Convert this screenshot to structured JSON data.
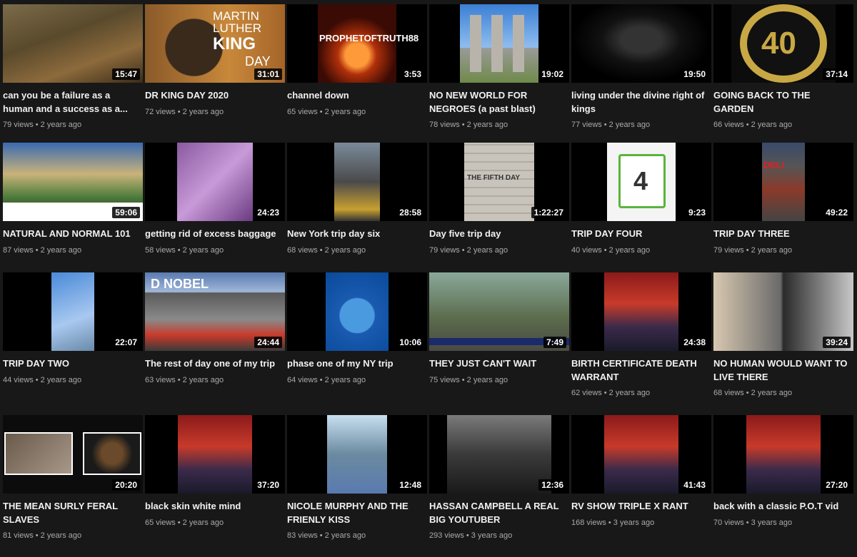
{
  "videos": [
    {
      "title": "can you be a failure as a human and a success as a...",
      "views": "79 views",
      "age": "2 years ago",
      "duration": "15:47"
    },
    {
      "title": "DR KING DAY 2020",
      "views": "72 views",
      "age": "2 years ago",
      "duration": "31:01",
      "art_text": [
        "MARTIN LUTHER",
        "KING",
        "DAY"
      ]
    },
    {
      "title": "channel down",
      "views": "65 views",
      "age": "2 years ago",
      "duration": "3:53",
      "art_text": [
        "PROPHETOFTRUTH88"
      ]
    },
    {
      "title": "NO NEW WORLD FOR NEGROES (a past blast)",
      "views": "78 views",
      "age": "2 years ago",
      "duration": "19:02"
    },
    {
      "title": "living under the divine right of kings",
      "views": "77 views",
      "age": "2 years ago",
      "duration": "19:50"
    },
    {
      "title": "GOING BACK TO THE GARDEN",
      "views": "66 views",
      "age": "2 years ago",
      "duration": "37:14",
      "art_text": [
        "40"
      ]
    },
    {
      "title": "NATURAL AND NORMAL 101",
      "views": "87 views",
      "age": "2 years ago",
      "duration": "59:06"
    },
    {
      "title": "getting rid of excess baggage",
      "views": "58 views",
      "age": "2 years ago",
      "duration": "24:23"
    },
    {
      "title": "New York trip day six",
      "views": "68 views",
      "age": "2 years ago",
      "duration": "28:58"
    },
    {
      "title": "Day five trip day",
      "views": "79 views",
      "age": "2 years ago",
      "duration": "1:22:27",
      "art_text": [
        "THE FIFTH DAY"
      ]
    },
    {
      "title": "TRIP DAY FOUR",
      "views": "40 views",
      "age": "2 years ago",
      "duration": "9:23",
      "art_text": [
        "4"
      ]
    },
    {
      "title": "TRIP DAY THREE",
      "views": "79 views",
      "age": "2 years ago",
      "duration": "49:22",
      "art_text": [
        "DELI"
      ]
    },
    {
      "title": "TRIP DAY TWO",
      "views": "44 views",
      "age": "2 years ago",
      "duration": "22:07"
    },
    {
      "title": "The rest of day one of my trip",
      "views": "63 views",
      "age": "2 years ago",
      "duration": "24:44",
      "art_text": [
        "D NOBEL"
      ]
    },
    {
      "title": "phase one of my NY trip",
      "views": "64 views",
      "age": "2 years ago",
      "duration": "10:06"
    },
    {
      "title": "THEY JUST CAN'T WAIT",
      "views": "75 views",
      "age": "2 years ago",
      "duration": "7:49"
    },
    {
      "title": "BIRTH CERTIFICATE DEATH WARRANT",
      "views": "62 views",
      "age": "2 years ago",
      "duration": "24:38"
    },
    {
      "title": "NO HUMAN WOULD WANT TO LIVE THERE",
      "views": "68 views",
      "age": "2 years ago",
      "duration": "39:24"
    },
    {
      "title": "THE MEAN SURLY FERAL SLAVES",
      "views": "81 views",
      "age": "2 years ago",
      "duration": "20:20"
    },
    {
      "title": "black skin white mind",
      "views": "65 views",
      "age": "2 years ago",
      "duration": "37:20"
    },
    {
      "title": "NICOLE MURPHY AND THE FRIENLY KISS",
      "views": "83 views",
      "age": "2 years ago",
      "duration": "12:48"
    },
    {
      "title": "HASSAN CAMPBELL A REAL BIG YOUTUBER",
      "views": "293 views",
      "age": "3 years ago",
      "duration": "12:36"
    },
    {
      "title": "RV SHOW TRIPLE X RANT",
      "views": "168 views",
      "age": "3 years ago",
      "duration": "41:43"
    },
    {
      "title": "back with a classic P.O.T vid",
      "views": "70 views",
      "age": "3 years ago",
      "duration": "27:20"
    }
  ],
  "separator": "•"
}
